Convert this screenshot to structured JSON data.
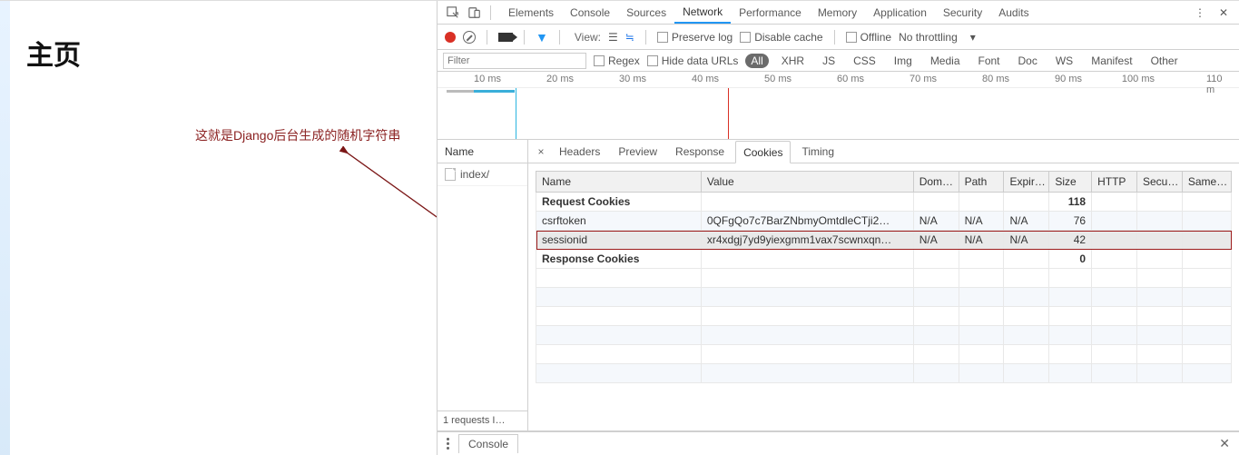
{
  "page": {
    "title": "主页"
  },
  "annotation": {
    "text": "这就是Django后台生成的随机字符串"
  },
  "devtools": {
    "panels": [
      "Elements",
      "Console",
      "Sources",
      "Network",
      "Performance",
      "Memory",
      "Application",
      "Security",
      "Audits"
    ],
    "activePanel": "Network",
    "toolbar": {
      "viewLabel": "View:",
      "preserveLog": "Preserve log",
      "disableCache": "Disable cache",
      "offline": "Offline",
      "throttling": "No throttling"
    },
    "filterbar": {
      "placeholder": "Filter",
      "regex": "Regex",
      "hideDataUrls": "Hide data URLs",
      "types": [
        "All",
        "XHR",
        "JS",
        "CSS",
        "Img",
        "Media",
        "Font",
        "Doc",
        "WS",
        "Manifest",
        "Other"
      ],
      "activeType": "All"
    },
    "timeline": {
      "ticks": [
        "10 ms",
        "20 ms",
        "30 ms",
        "40 ms",
        "50 ms",
        "60 ms",
        "70 ms",
        "80 ms",
        "90 ms",
        "100 ms",
        "110 m"
      ]
    },
    "requests": {
      "header": "Name",
      "items": [
        "index/"
      ],
      "footer": "1 requests  I…"
    },
    "detailTabs": [
      "Headers",
      "Preview",
      "Response",
      "Cookies",
      "Timing"
    ],
    "activeDetailTab": "Cookies",
    "cookies": {
      "cols": [
        "Name",
        "Value",
        "Dom…",
        "Path",
        "Expir…",
        "Size",
        "HTTP",
        "Secu…",
        "Same…"
      ],
      "requestLabel": "Request Cookies",
      "responseLabel": "Response Cookies",
      "requestTotal": "118",
      "responseTotal": "0",
      "rows": [
        {
          "name": "csrftoken",
          "value": "0QFgQo7c7BarZNbmyOmtdleCTji2…",
          "domain": "N/A",
          "path": "N/A",
          "expires": "N/A",
          "size": "76",
          "http": "",
          "secure": "",
          "same": ""
        },
        {
          "name": "sessionid",
          "value": "xr4xdgj7yd9yiexgmm1vax7scwnxqn…",
          "domain": "N/A",
          "path": "N/A",
          "expires": "N/A",
          "size": "42",
          "http": "",
          "secure": "",
          "same": ""
        }
      ]
    },
    "drawer": {
      "tab": "Console"
    }
  }
}
